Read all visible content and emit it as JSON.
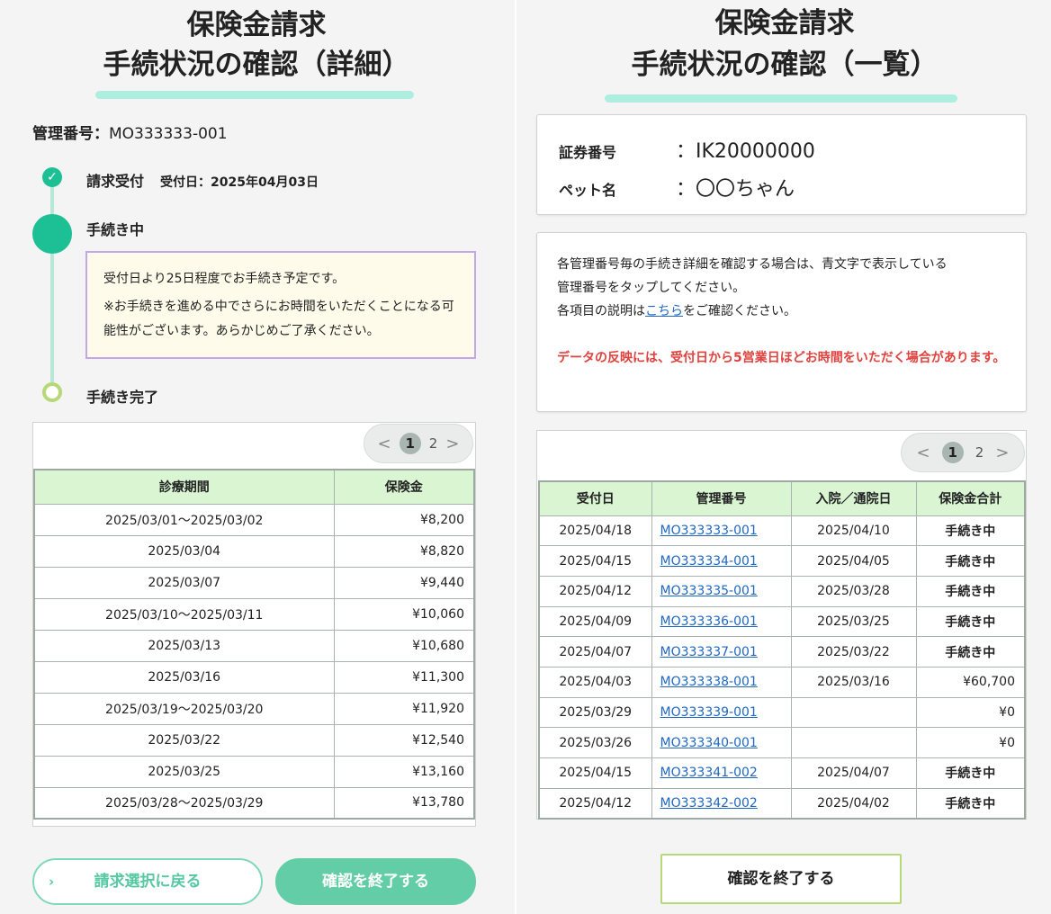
{
  "left": {
    "title_line1": "保険金請求",
    "title_line2": "手続状況の確認（詳細）",
    "mgmt_label": "管理番号：",
    "mgmt_value": "MO333333-001",
    "steps": [
      {
        "label": "請求受付",
        "date": "受付日：2025年04月03日",
        "state": "done"
      },
      {
        "label": "手続き中",
        "state": "current"
      },
      {
        "label": "手続き完了",
        "state": "pending"
      }
    ],
    "notice_line1": "受付日より25日程度でお手続き予定です。",
    "notice_line2": "※お手続きを進める中でさらにお時間をいただくことになる可能性がございます。あらかじめご了承ください。",
    "pager": {
      "prev": "<",
      "pages": [
        "1",
        "2"
      ],
      "current": "1",
      "next": ">"
    },
    "table": {
      "headers": [
        "診療期間",
        "保険金"
      ],
      "rows": [
        [
          "2025/03/01～2025/03/02",
          "¥8,200"
        ],
        [
          "2025/03/04",
          "¥8,820"
        ],
        [
          "2025/03/07",
          "¥9,440"
        ],
        [
          "2025/03/10～2025/03/11",
          "¥10,060"
        ],
        [
          "2025/03/13",
          "¥10,680"
        ],
        [
          "2025/03/16",
          "¥11,300"
        ],
        [
          "2025/03/19～2025/03/20",
          "¥11,920"
        ],
        [
          "2025/03/22",
          "¥12,540"
        ],
        [
          "2025/03/25",
          "¥13,160"
        ],
        [
          "2025/03/28～2025/03/29",
          "¥13,780"
        ]
      ]
    },
    "back_button": "請求選択に戻る",
    "back_chevron": "›",
    "end_button": "確認を終了する"
  },
  "right": {
    "title_line1": "保険金請求",
    "title_line2": "手続状況の確認（一覧）",
    "policy_label": "証券番号",
    "policy_value": "：IK20000000",
    "pet_label": "ペット名",
    "pet_value": "：〇〇ちゃん",
    "desc_line1": "各管理番号毎の手続き詳細を確認する場合は、青文字で表示している",
    "desc_line2": "管理番号をタップしてください。",
    "desc_line3_pre": "各項目の説明は",
    "desc_line3_link": "こちら",
    "desc_line3_post": "をご確認ください。",
    "warning": "データの反映には、受付日から5営業日ほどお時間をいただく場合があります。",
    "pager": {
      "prev": "<",
      "pages": [
        "1",
        "2"
      ],
      "current": "1",
      "next": ">"
    },
    "table": {
      "headers": [
        "受付日",
        "管理番号",
        "入院／通院日",
        "保険金合計"
      ],
      "rows": [
        [
          "2025/04/18",
          "MO333333-001",
          "2025/04/10",
          "手続き中"
        ],
        [
          "2025/04/15",
          "MO333334-001",
          "2025/04/05",
          "手続き中"
        ],
        [
          "2025/04/12",
          "MO333335-001",
          "2025/03/28",
          "手続き中"
        ],
        [
          "2025/04/09",
          "MO333336-001",
          "2025/03/25",
          "手続き中"
        ],
        [
          "2025/04/07",
          "MO333337-001",
          "2025/03/22",
          "手続き中"
        ],
        [
          "2025/04/03",
          "MO333338-001",
          "2025/03/16",
          "¥60,700"
        ],
        [
          "2025/03/29",
          "MO333339-001",
          "",
          "¥0"
        ],
        [
          "2025/03/26",
          "MO333340-001",
          "",
          "¥0"
        ],
        [
          "2025/04/15",
          "MO333341-002",
          "2025/04/07",
          "手続き中"
        ],
        [
          "2025/04/12",
          "MO333342-002",
          "2025/04/02",
          "手続き中"
        ]
      ]
    },
    "end_button": "確認を終了する"
  }
}
